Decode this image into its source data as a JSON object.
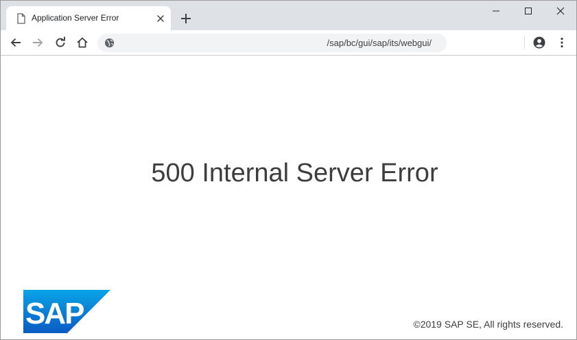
{
  "browser": {
    "tab": {
      "title": "Application Server Error",
      "icon": "page-icon"
    },
    "address_bar": {
      "url": "/sap/bc/gui/sap/its/webgui/",
      "icon": "globe-icon"
    },
    "nav_icons": [
      "back-arrow-icon",
      "forward-arrow-icon",
      "reload-icon",
      "home-icon"
    ],
    "toolbar_icons": [
      "profile-icon",
      "kebab-menu-icon"
    ],
    "window_controls": [
      "minimize-icon",
      "maximize-icon",
      "close-icon"
    ]
  },
  "page": {
    "heading": "500 Internal Server Error",
    "copyright": "©2019 SAP SE, All rights reserved.",
    "logo": {
      "text": "SAP",
      "color": "#0a6ed1"
    }
  },
  "colors": {
    "tab_strip": "#dee1e6",
    "omnibox": "#f1f3f4",
    "heading_text": "#3d3d3d",
    "sap_blue": "#0a6ed1"
  }
}
